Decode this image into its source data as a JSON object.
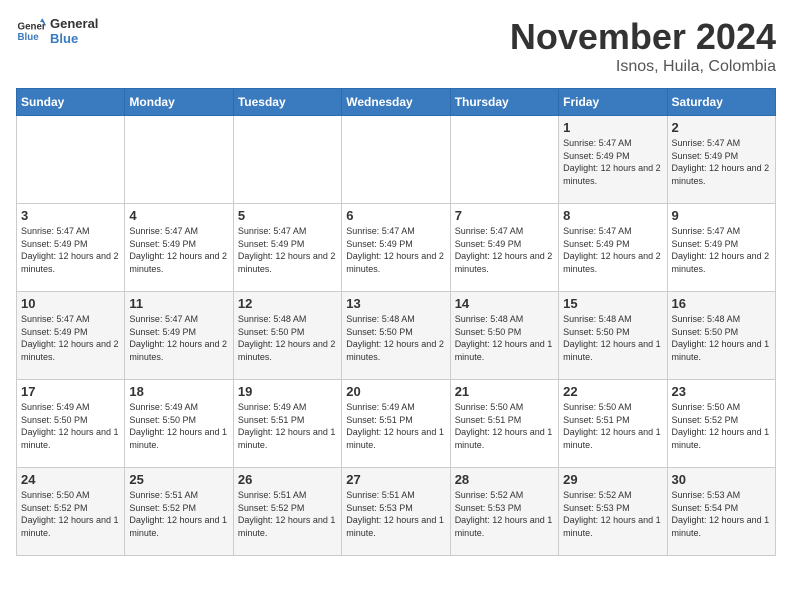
{
  "header": {
    "logo_line1": "General",
    "logo_line2": "Blue",
    "month": "November 2024",
    "location": "Isnos, Huila, Colombia"
  },
  "weekdays": [
    "Sunday",
    "Monday",
    "Tuesday",
    "Wednesday",
    "Thursday",
    "Friday",
    "Saturday"
  ],
  "weeks": [
    [
      {
        "day": "",
        "info": ""
      },
      {
        "day": "",
        "info": ""
      },
      {
        "day": "",
        "info": ""
      },
      {
        "day": "",
        "info": ""
      },
      {
        "day": "",
        "info": ""
      },
      {
        "day": "1",
        "info": "Sunrise: 5:47 AM\nSunset: 5:49 PM\nDaylight: 12 hours and 2 minutes."
      },
      {
        "day": "2",
        "info": "Sunrise: 5:47 AM\nSunset: 5:49 PM\nDaylight: 12 hours and 2 minutes."
      }
    ],
    [
      {
        "day": "3",
        "info": "Sunrise: 5:47 AM\nSunset: 5:49 PM\nDaylight: 12 hours and 2 minutes."
      },
      {
        "day": "4",
        "info": "Sunrise: 5:47 AM\nSunset: 5:49 PM\nDaylight: 12 hours and 2 minutes."
      },
      {
        "day": "5",
        "info": "Sunrise: 5:47 AM\nSunset: 5:49 PM\nDaylight: 12 hours and 2 minutes."
      },
      {
        "day": "6",
        "info": "Sunrise: 5:47 AM\nSunset: 5:49 PM\nDaylight: 12 hours and 2 minutes."
      },
      {
        "day": "7",
        "info": "Sunrise: 5:47 AM\nSunset: 5:49 PM\nDaylight: 12 hours and 2 minutes."
      },
      {
        "day": "8",
        "info": "Sunrise: 5:47 AM\nSunset: 5:49 PM\nDaylight: 12 hours and 2 minutes."
      },
      {
        "day": "9",
        "info": "Sunrise: 5:47 AM\nSunset: 5:49 PM\nDaylight: 12 hours and 2 minutes."
      }
    ],
    [
      {
        "day": "10",
        "info": "Sunrise: 5:47 AM\nSunset: 5:49 PM\nDaylight: 12 hours and 2 minutes."
      },
      {
        "day": "11",
        "info": "Sunrise: 5:47 AM\nSunset: 5:49 PM\nDaylight: 12 hours and 2 minutes."
      },
      {
        "day": "12",
        "info": "Sunrise: 5:48 AM\nSunset: 5:50 PM\nDaylight: 12 hours and 2 minutes."
      },
      {
        "day": "13",
        "info": "Sunrise: 5:48 AM\nSunset: 5:50 PM\nDaylight: 12 hours and 2 minutes."
      },
      {
        "day": "14",
        "info": "Sunrise: 5:48 AM\nSunset: 5:50 PM\nDaylight: 12 hours and 1 minute."
      },
      {
        "day": "15",
        "info": "Sunrise: 5:48 AM\nSunset: 5:50 PM\nDaylight: 12 hours and 1 minute."
      },
      {
        "day": "16",
        "info": "Sunrise: 5:48 AM\nSunset: 5:50 PM\nDaylight: 12 hours and 1 minute."
      }
    ],
    [
      {
        "day": "17",
        "info": "Sunrise: 5:49 AM\nSunset: 5:50 PM\nDaylight: 12 hours and 1 minute."
      },
      {
        "day": "18",
        "info": "Sunrise: 5:49 AM\nSunset: 5:50 PM\nDaylight: 12 hours and 1 minute."
      },
      {
        "day": "19",
        "info": "Sunrise: 5:49 AM\nSunset: 5:51 PM\nDaylight: 12 hours and 1 minute."
      },
      {
        "day": "20",
        "info": "Sunrise: 5:49 AM\nSunset: 5:51 PM\nDaylight: 12 hours and 1 minute."
      },
      {
        "day": "21",
        "info": "Sunrise: 5:50 AM\nSunset: 5:51 PM\nDaylight: 12 hours and 1 minute."
      },
      {
        "day": "22",
        "info": "Sunrise: 5:50 AM\nSunset: 5:51 PM\nDaylight: 12 hours and 1 minute."
      },
      {
        "day": "23",
        "info": "Sunrise: 5:50 AM\nSunset: 5:52 PM\nDaylight: 12 hours and 1 minute."
      }
    ],
    [
      {
        "day": "24",
        "info": "Sunrise: 5:50 AM\nSunset: 5:52 PM\nDaylight: 12 hours and 1 minute."
      },
      {
        "day": "25",
        "info": "Sunrise: 5:51 AM\nSunset: 5:52 PM\nDaylight: 12 hours and 1 minute."
      },
      {
        "day": "26",
        "info": "Sunrise: 5:51 AM\nSunset: 5:52 PM\nDaylight: 12 hours and 1 minute."
      },
      {
        "day": "27",
        "info": "Sunrise: 5:51 AM\nSunset: 5:53 PM\nDaylight: 12 hours and 1 minute."
      },
      {
        "day": "28",
        "info": "Sunrise: 5:52 AM\nSunset: 5:53 PM\nDaylight: 12 hours and 1 minute."
      },
      {
        "day": "29",
        "info": "Sunrise: 5:52 AM\nSunset: 5:53 PM\nDaylight: 12 hours and 1 minute."
      },
      {
        "day": "30",
        "info": "Sunrise: 5:53 AM\nSunset: 5:54 PM\nDaylight: 12 hours and 1 minute."
      }
    ]
  ]
}
